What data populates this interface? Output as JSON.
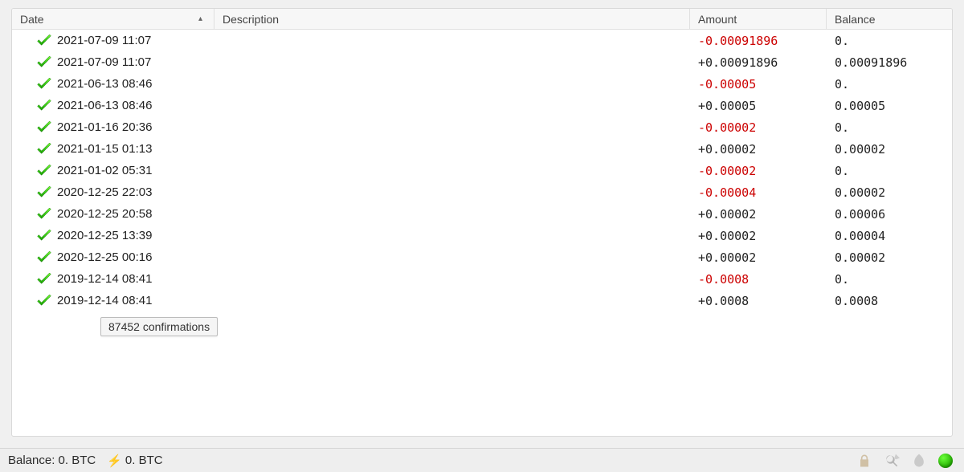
{
  "columns": {
    "date": "Date",
    "description": "Description",
    "amount": "Amount",
    "balance": "Balance",
    "sort_indicator": "▴"
  },
  "transactions": [
    {
      "date": "2021-07-09 11:07",
      "desc": "",
      "amount": "-0.00091896",
      "neg": true,
      "balance": "0."
    },
    {
      "date": "2021-07-09 11:07",
      "desc": "",
      "amount": "+0.00091896",
      "neg": false,
      "balance": "0.00091896"
    },
    {
      "date": "2021-06-13 08:46",
      "desc": "",
      "amount": "-0.00005",
      "neg": true,
      "balance": "0."
    },
    {
      "date": "2021-06-13 08:46",
      "desc": "",
      "amount": "+0.00005",
      "neg": false,
      "balance": "0.00005"
    },
    {
      "date": "2021-01-16 20:36",
      "desc": "",
      "amount": "-0.00002",
      "neg": true,
      "balance": "0."
    },
    {
      "date": "2021-01-15 01:13",
      "desc": "",
      "amount": "+0.00002",
      "neg": false,
      "balance": "0.00002"
    },
    {
      "date": "2021-01-02 05:31",
      "desc": "",
      "amount": "-0.00002",
      "neg": true,
      "balance": "0."
    },
    {
      "date": "2020-12-25 22:03",
      "desc": "",
      "amount": "-0.00004",
      "neg": true,
      "balance": "0.00002"
    },
    {
      "date": "2020-12-25 20:58",
      "desc": "",
      "amount": "+0.00002",
      "neg": false,
      "balance": "0.00006"
    },
    {
      "date": "2020-12-25 13:39",
      "desc": "",
      "amount": "+0.00002",
      "neg": false,
      "balance": "0.00004"
    },
    {
      "date": "2020-12-25 00:16",
      "desc": "",
      "amount": "+0.00002",
      "neg": false,
      "balance": "0.00002"
    },
    {
      "date": "2019-12-14 08:41",
      "desc": "",
      "amount": "-0.0008",
      "neg": true,
      "balance": "0."
    },
    {
      "date": "2019-12-14 08:41",
      "desc": "",
      "amount": "+0.0008",
      "neg": false,
      "balance": "0.0008"
    }
  ],
  "tooltip": "87452 confirmations",
  "status": {
    "balance_label": "Balance:",
    "balance_value": "0. BTC",
    "lightning_symbol": "⚡",
    "lightning_value": "0. BTC"
  }
}
